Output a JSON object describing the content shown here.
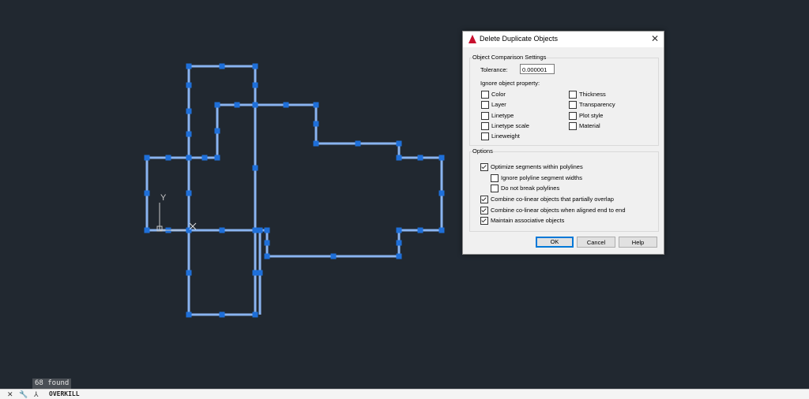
{
  "dialog": {
    "title": "Delete Duplicate Objects",
    "comparison_group": "Object Comparison Settings",
    "tolerance_label": "Tolerance:",
    "tolerance_value": "0.000001",
    "ignore_label": "Ignore object property:",
    "properties_left": [
      {
        "label": "Color",
        "checked": false
      },
      {
        "label": "Layer",
        "checked": false
      },
      {
        "label": "Linetype",
        "checked": false
      },
      {
        "label": "Linetype scale",
        "checked": false
      },
      {
        "label": "Lineweight",
        "checked": false
      }
    ],
    "properties_right": [
      {
        "label": "Thickness",
        "checked": false
      },
      {
        "label": "Transparency",
        "checked": false
      },
      {
        "label": "Plot style",
        "checked": false
      },
      {
        "label": "Material",
        "checked": false
      }
    ],
    "options_group": "Options",
    "options": [
      {
        "label": "Optimize segments within polylines",
        "checked": true
      },
      {
        "label": "Ignore polyline segment widths",
        "checked": false
      },
      {
        "label": "Do not break polylines",
        "checked": false
      },
      {
        "label": "Combine co-linear objects that partially overlap",
        "checked": true
      },
      {
        "label": "Combine co-linear objects when aligned end to end",
        "checked": true
      },
      {
        "label": "Maintain associative objects",
        "checked": true
      }
    ],
    "buttons": {
      "ok": "OK",
      "cancel": "Cancel",
      "help": "Help"
    }
  },
  "status": {
    "found": "68 found"
  },
  "command_line": {
    "command": "OVERKILL"
  },
  "ucs": {
    "y_label": "Y"
  },
  "colors": {
    "background": "#212830",
    "line": "#8ab4f0",
    "grip": "#1e6fd9"
  }
}
